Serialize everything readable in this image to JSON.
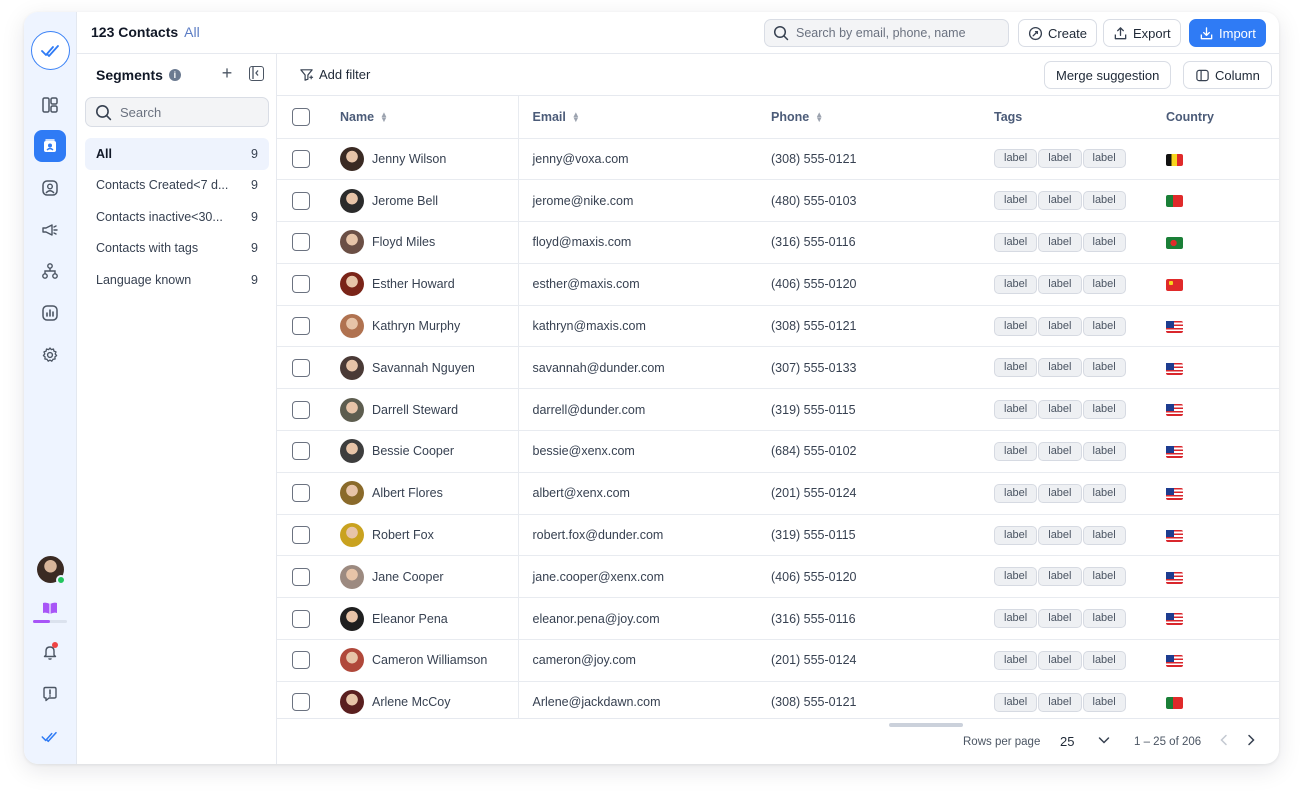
{
  "header": {
    "title": "123 Contacts",
    "subtitle": "All",
    "search_placeholder": "Search by email, phone, name",
    "create_label": "Create",
    "export_label": "Export",
    "import_label": "Import"
  },
  "rail": {
    "icons": [
      "logo-check-icon",
      "layout-icon",
      "contacts-icon",
      "user-circle-icon",
      "megaphone-icon",
      "hierarchy-icon",
      "analytics-icon",
      "settings-icon"
    ],
    "active": "contacts-icon",
    "bottom_icons": [
      "avatar",
      "book-icon",
      "bell-icon",
      "help-icon",
      "brand-check-icon"
    ],
    "progress": 0.5,
    "colors": {
      "accent": "#2f7bf5",
      "online": "#22c55e",
      "book": "#a855f7"
    }
  },
  "segments": {
    "title": "Segments",
    "search_placeholder": "Search",
    "items": [
      {
        "label": "All",
        "count": "9",
        "active": true
      },
      {
        "label": "Contacts Created<7 d...",
        "count": "9"
      },
      {
        "label": "Contacts inactive<30...",
        "count": "9"
      },
      {
        "label": "Contacts with tags",
        "count": "9"
      },
      {
        "label": "Language known",
        "count": "9"
      }
    ]
  },
  "toolbar": {
    "add_filter_label": "Add filter",
    "merge_label": "Merge suggestion",
    "column_label": "Column"
  },
  "table": {
    "columns": [
      "Name",
      "Email",
      "Phone",
      "Tags",
      "Country"
    ],
    "rows": [
      {
        "name": "Jenny Wilson",
        "email": "jenny@voxa.com",
        "phone": "(308) 555-0121",
        "tags": [
          "label",
          "label",
          "label"
        ],
        "country": "BE",
        "avatar_color": "#3a2a23"
      },
      {
        "name": "Jerome Bell",
        "email": "jerome@nike.com",
        "phone": "(480) 555-0103",
        "tags": [
          "label",
          "label",
          "label"
        ],
        "country": "PT",
        "avatar_color": "#2b2b2b"
      },
      {
        "name": "Floyd Miles",
        "email": "floyd@maxis.com",
        "phone": "(316) 555-0116",
        "tags": [
          "label",
          "label",
          "label"
        ],
        "country": "BD",
        "avatar_color": "#6b4f45"
      },
      {
        "name": "Esther Howard",
        "email": "esther@maxis.com",
        "phone": "(406) 555-0120",
        "tags": [
          "label",
          "label",
          "label"
        ],
        "country": "CN",
        "avatar_color": "#7a2418"
      },
      {
        "name": "Kathryn Murphy",
        "email": "kathryn@maxis.com",
        "phone": "(308) 555-0121",
        "tags": [
          "label",
          "label",
          "label"
        ],
        "country": "MY",
        "avatar_color": "#b07250"
      },
      {
        "name": "Savannah Nguyen",
        "email": "savannah@dunder.com",
        "phone": "(307) 555-0133",
        "tags": [
          "label",
          "label",
          "label"
        ],
        "country": "MY",
        "avatar_color": "#4a3a36"
      },
      {
        "name": "Darrell Steward",
        "email": "darrell@dunder.com",
        "phone": "(319) 555-0115",
        "tags": [
          "label",
          "label",
          "label"
        ],
        "country": "MY",
        "avatar_color": "#5d5d4f"
      },
      {
        "name": "Bessie Cooper",
        "email": "bessie@xenx.com",
        "phone": "(684) 555-0102",
        "tags": [
          "label",
          "label",
          "label"
        ],
        "country": "MY",
        "avatar_color": "#3d3d3d"
      },
      {
        "name": "Albert Flores",
        "email": "albert@xenx.com",
        "phone": "(201) 555-0124",
        "tags": [
          "label",
          "label",
          "label"
        ],
        "country": "MY",
        "avatar_color": "#8a6a2a"
      },
      {
        "name": "Robert Fox",
        "email": "robert.fox@dunder.com",
        "phone": "(319) 555-0115",
        "tags": [
          "label",
          "label",
          "label"
        ],
        "country": "MY",
        "avatar_color": "#c9a21f"
      },
      {
        "name": "Jane Cooper",
        "email": "jane.cooper@xenx.com",
        "phone": "(406) 555-0120",
        "tags": [
          "label",
          "label",
          "label"
        ],
        "country": "MY",
        "avatar_color": "#9c8a80"
      },
      {
        "name": "Eleanor Pena",
        "email": "eleanor.pena@joy.com",
        "phone": "(316) 555-0116",
        "tags": [
          "label",
          "label",
          "label"
        ],
        "country": "MY",
        "avatar_color": "#1f1f1f"
      },
      {
        "name": "Cameron Williamson",
        "email": "cameron@joy.com",
        "phone": "(201) 555-0124",
        "tags": [
          "label",
          "label",
          "label"
        ],
        "country": "MY",
        "avatar_color": "#b0483a"
      },
      {
        "name": "Arlene McCoy",
        "email": "Arlene@jackdawn.com",
        "phone": "(308) 555-0121",
        "tags": [
          "label",
          "label",
          "label"
        ],
        "country": "PT",
        "avatar_color": "#5a1f1f"
      }
    ]
  },
  "pagination": {
    "rows_per_page_label": "Rows per page",
    "rows_per_page": "25",
    "range_label": "1 – 25 of 206"
  }
}
